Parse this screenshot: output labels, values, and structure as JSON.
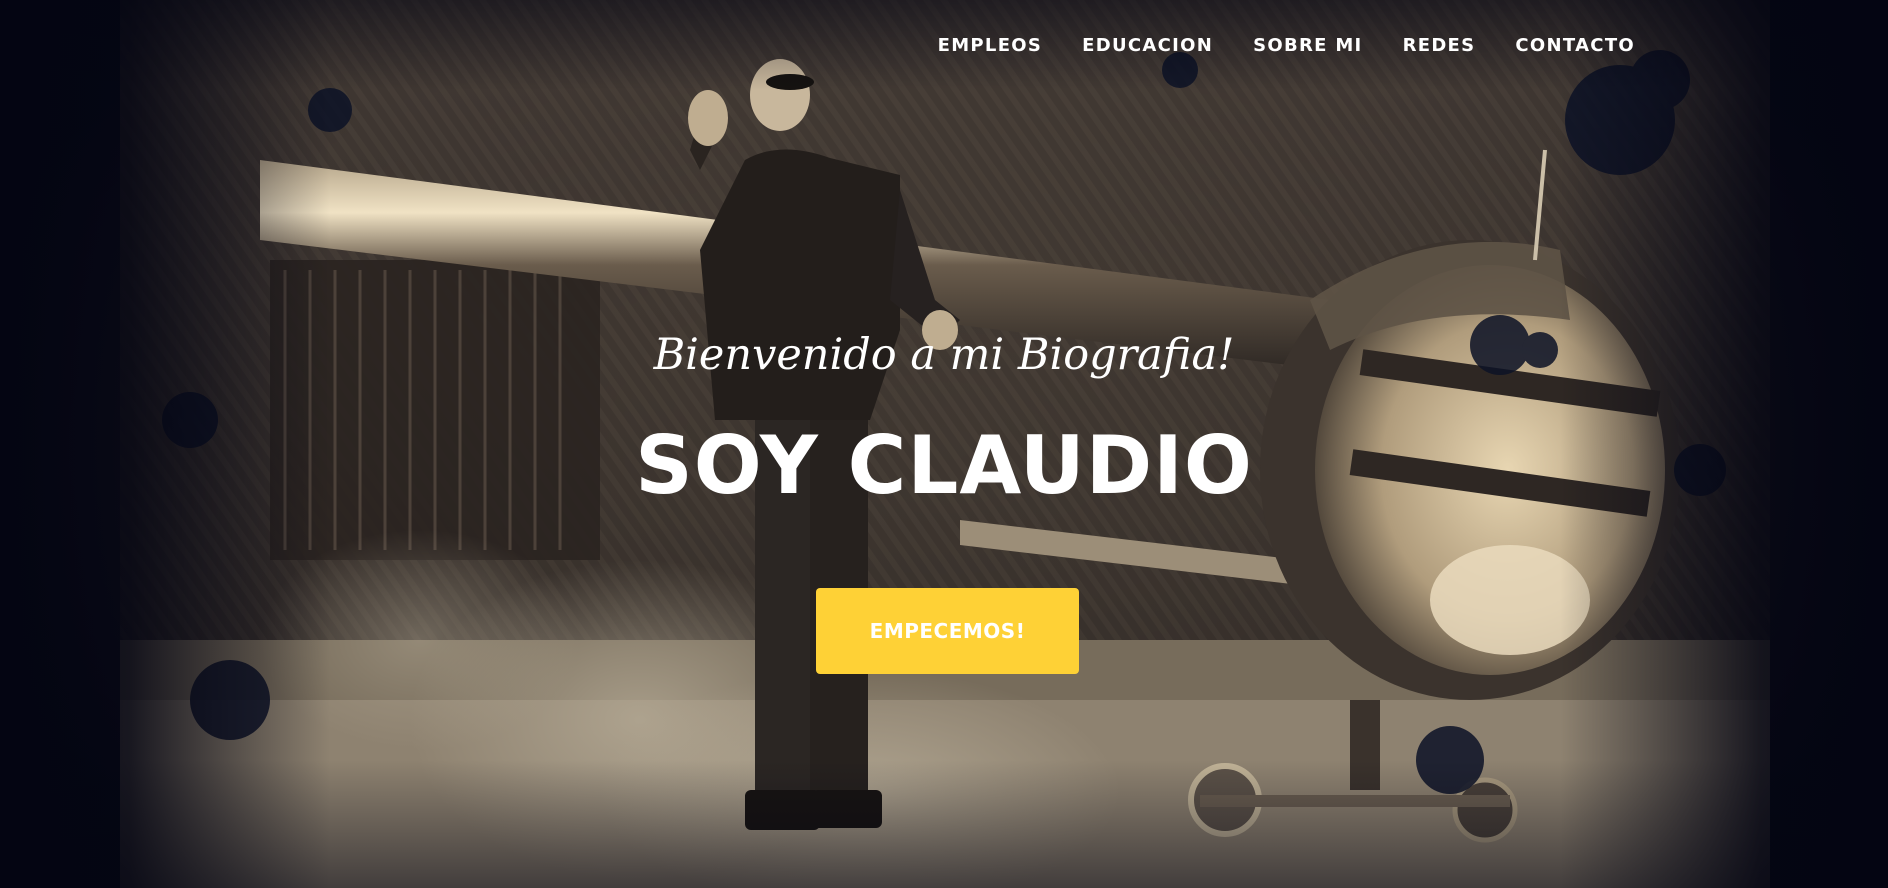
{
  "nav": {
    "items": [
      {
        "label": "EMPLEOS"
      },
      {
        "label": "EDUCACION"
      },
      {
        "label": "SOBRE MI"
      },
      {
        "label": "REDES"
      },
      {
        "label": "CONTACTO"
      }
    ]
  },
  "hero": {
    "intro": "Bienvenido a mi Biografia!",
    "heading": "SOY CLAUDIO",
    "cta_label": "EMPECEMOS!",
    "photo_icon": "man-with-airplane-photo"
  },
  "colors": {
    "accent": "#fed136",
    "text": "#ffffff",
    "background": "#05060f"
  }
}
